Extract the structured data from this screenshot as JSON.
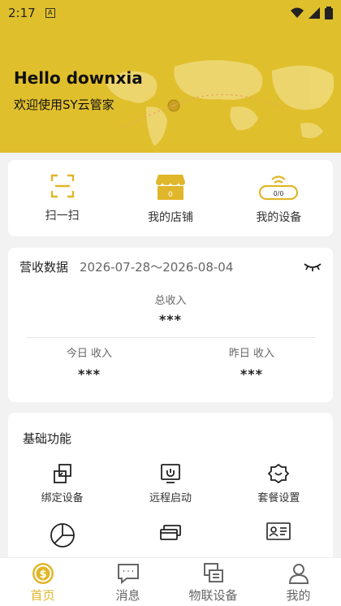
{
  "status_bar": {
    "time": "2:17",
    "notification_glyph": "A"
  },
  "header": {
    "greeting": "Hello downxia",
    "welcome": "欢迎使用SY云管家",
    "bg_color": "#e0bf2d"
  },
  "quick_actions": {
    "items": [
      {
        "label": "扫一扫",
        "icon": "scan-icon"
      },
      {
        "label": "我的店铺",
        "icon": "store-icon",
        "badge": "0"
      },
      {
        "label": "我的设备",
        "icon": "device-icon",
        "badge": "0/0"
      }
    ]
  },
  "revenue": {
    "title": "营收数据",
    "date_range": "2026-07-28～2026-08-04",
    "total_label": "总收入",
    "total_value": "***",
    "today_label": "今日 收入",
    "today_value": "***",
    "yesterday_label": "昨日 收入",
    "yesterday_value": "***"
  },
  "basic_functions": {
    "title": "基础功能",
    "items": [
      {
        "label": "绑定设备",
        "icon": "bind-device-icon"
      },
      {
        "label": "远程启动",
        "icon": "remote-start-icon"
      },
      {
        "label": "套餐设置",
        "icon": "package-settings-icon"
      },
      {
        "label": "",
        "icon": "pie-chart-icon"
      },
      {
        "label": "",
        "icon": "card-icon"
      },
      {
        "label": "",
        "icon": "id-card-icon"
      }
    ]
  },
  "bottom_nav": {
    "tabs": [
      {
        "label": "首页",
        "icon": "home-coin-icon",
        "active": true
      },
      {
        "label": "消息",
        "icon": "message-icon",
        "active": false
      },
      {
        "label": "物联设备",
        "icon": "iot-device-icon",
        "active": false
      },
      {
        "label": "我的",
        "icon": "profile-icon",
        "active": false
      }
    ],
    "accent_color": "#e0b62a"
  }
}
